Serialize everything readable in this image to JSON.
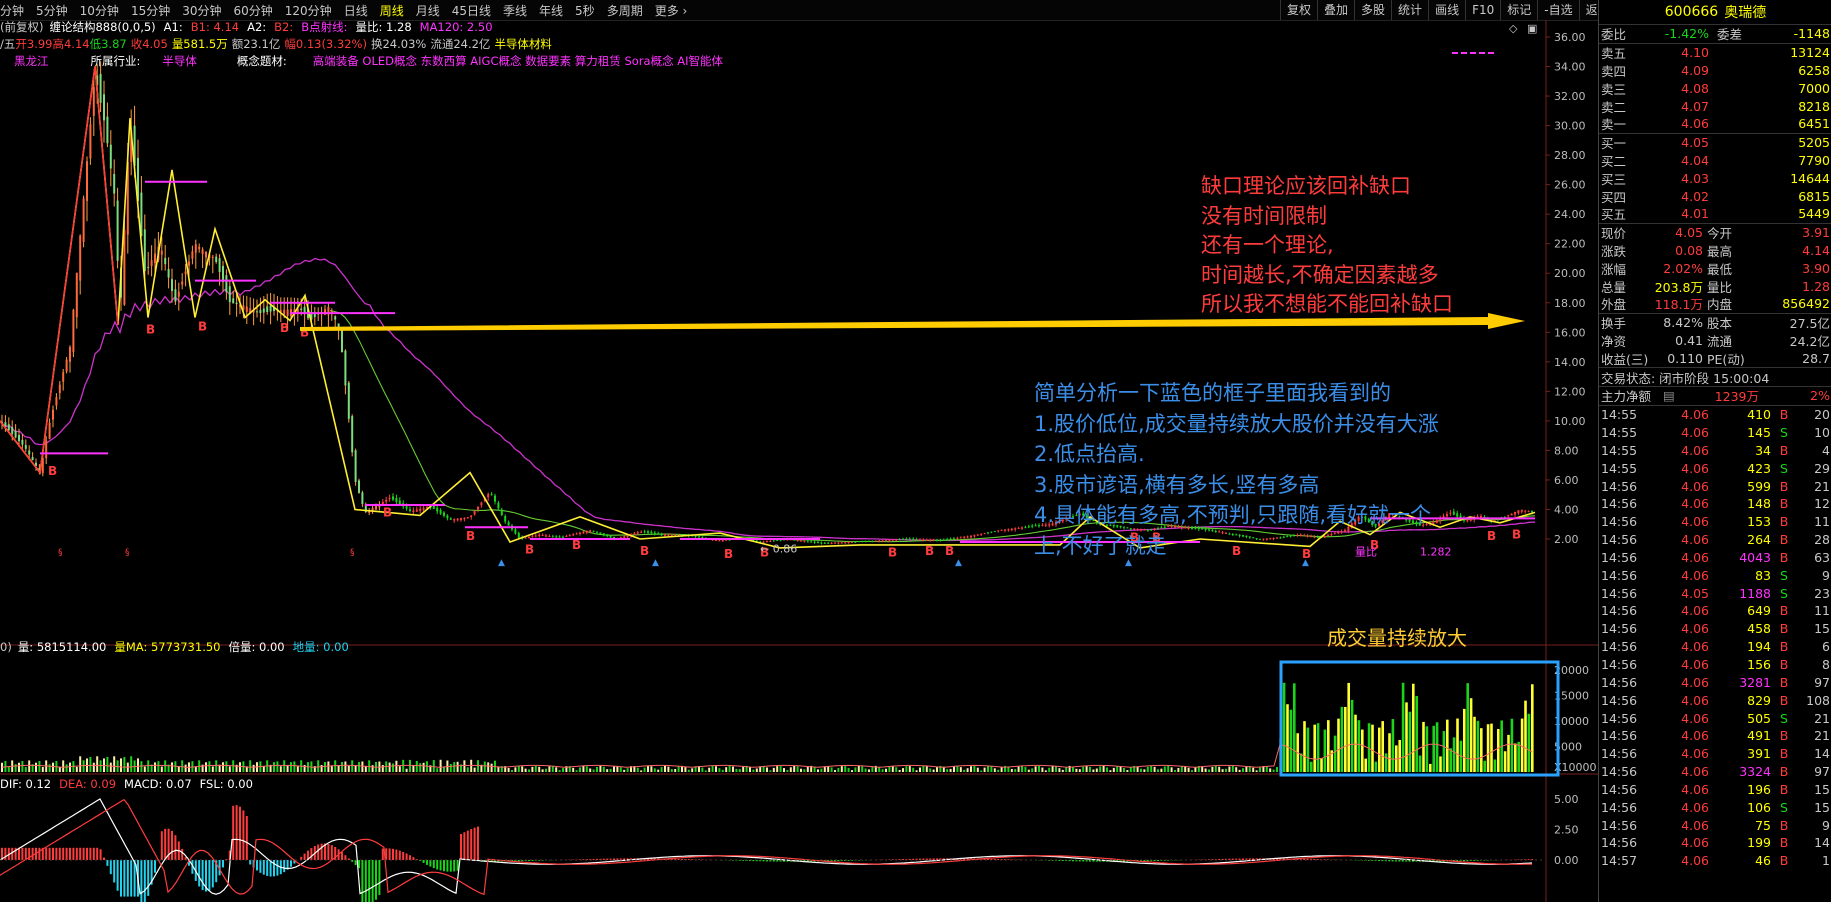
{
  "toolbar": {
    "periods": [
      "分钟",
      "5分钟",
      "10分钟",
      "15分钟",
      "30分钟",
      "60分钟",
      "120分钟",
      "日线",
      "周线",
      "月线",
      "45日线",
      "季线",
      "年线",
      "5秒",
      "多周期",
      "更多 ›"
    ],
    "active_period": "周线",
    "right_buttons": [
      "复权",
      "叠加",
      "多股",
      "统计",
      "画线",
      "F10",
      "标记",
      "-自选",
      "返回"
    ]
  },
  "info_line1": {
    "prefix": "(前复权)",
    "indicator": "缠论结构888(0,0,5)",
    "a1_label": "A1:",
    "b1": "B1: 4.14",
    "a2_label": "A2:",
    "b2_label": "B2:",
    "bline": "B点射线:",
    "volratio": "量比: 1.28",
    "ma120": "MA120: 2.50"
  },
  "info_line2": {
    "ohlc_prefix": "/五",
    "open": "开3.99",
    "high": "高4.14",
    "low": "低3.87",
    "close": "收4.05",
    "vol": "量581.5万",
    "amount": "额23.1亿",
    "amp": "幅0.13(3.32%)",
    "turnover": "换24.03%",
    "float": "流通24.2亿",
    "concept": "半导体材料"
  },
  "tags": {
    "region": "黑龙江",
    "industry_label": "所属行业:",
    "industry": "半导体",
    "concept_label": "概念题材:",
    "concepts": "高端装备 OLED概念 东数西算 AIGC概念 数据要素 算力租赁 Sora概念 AI智能体"
  },
  "price_axis": [
    "36.00",
    "34.00",
    "32.00",
    "30.00",
    "28.00",
    "26.00",
    "24.00",
    "22.00",
    "20.00",
    "18.00",
    "16.00",
    "14.00",
    "12.00",
    "10.00",
    "8.00",
    "6.00",
    "4.00",
    "2.00"
  ],
  "vol_axis": [
    "20000",
    "15000",
    "10000",
    "5000",
    "X10000"
  ],
  "macd_axis": [
    "5.00",
    "2.50",
    "0.00"
  ],
  "price_labels": {
    "low_marker": "0.86",
    "vol_ratio_marker": "量比",
    "vol_ratio_value": "1.282"
  },
  "vol_info": {
    "prefix": "0)",
    "vol": "量: 5815114.00",
    "volma": "量MA: 5773731.50",
    "bei": "倍量: 0.00",
    "di": "地量: 0.00"
  },
  "macd_info": {
    "dif": "DIF: 0.12",
    "dea": "DEA: 0.09",
    "macd": "MACD: 0.07",
    "fsl": "FSL: 0.00"
  },
  "annotations": {
    "gap_notes": [
      "缺口理论应该回补缺口",
      "没有时间限制",
      "还有一个理论,",
      "时间越长,不确定因素越多",
      "所以我不想能不能回补缺口"
    ],
    "analysis_notes": [
      "简单分析一下蓝色的框子里面我看到的",
      "1.股价低位,成交量持续放大股价并没有大涨",
      "2.低点抬高.",
      "3.股市谚语,横有多长,竖有多高",
      "4.具体能有多高,不预判,只跟随,看好就一个",
      "上,不好了就走"
    ],
    "volume_note": "成交量持续放大"
  },
  "quote": {
    "code": "600666",
    "name": "奥瑞德",
    "weibi_label": "委比",
    "weibi": "-1.42%",
    "weicha_label": "委差",
    "weicha": "-1148",
    "asks": [
      {
        "label": "卖五",
        "price": "4.10",
        "vol": "13124"
      },
      {
        "label": "卖四",
        "price": "4.09",
        "vol": "6258"
      },
      {
        "label": "卖三",
        "price": "4.08",
        "vol": "7000"
      },
      {
        "label": "卖二",
        "price": "4.07",
        "vol": "8218"
      },
      {
        "label": "卖一",
        "price": "4.06",
        "vol": "6451"
      }
    ],
    "bids": [
      {
        "label": "买一",
        "price": "4.05",
        "vol": "5205"
      },
      {
        "label": "买二",
        "price": "4.04",
        "vol": "7790"
      },
      {
        "label": "买三",
        "price": "4.03",
        "vol": "14644"
      },
      {
        "label": "买四",
        "price": "4.02",
        "vol": "6815"
      },
      {
        "label": "买五",
        "price": "4.01",
        "vol": "5449"
      }
    ],
    "stats": [
      {
        "l1": "现价",
        "v1": "4.05",
        "l2": "今开",
        "v2": "3.91"
      },
      {
        "l1": "涨跌",
        "v1": "0.08",
        "l2": "最高",
        "v2": "4.14"
      },
      {
        "l1": "涨幅",
        "v1": "2.02%",
        "l2": "最低",
        "v2": "3.90"
      },
      {
        "l1": "总量",
        "v1": "203.8万",
        "l2": "量比",
        "v2": "1.28"
      },
      {
        "l1": "外盘",
        "v1": "118.1万",
        "l2": "内盘",
        "v2": "856492"
      }
    ],
    "stats2": [
      {
        "l1": "换手",
        "v1": "8.42%",
        "l2": "股本",
        "v2": "27.5亿"
      },
      {
        "l1": "净资",
        "v1": "0.41",
        "l2": "流通",
        "v2": "24.2亿"
      },
      {
        "l1": "收益(三)",
        "v1": "0.110",
        "l2": "PE(动)",
        "v2": "28.7"
      }
    ],
    "trade_status": "交易状态: 闭市阶段 15:00:04",
    "flow_label": "主力净额",
    "flow_value": "1239万",
    "flow_pct": "2%",
    "ticks": [
      {
        "t": "14:55",
        "p": "4.06",
        "v": "410",
        "s": "B",
        "n": "20"
      },
      {
        "t": "14:55",
        "p": "4.06",
        "v": "145",
        "s": "S",
        "n": "10"
      },
      {
        "t": "14:55",
        "p": "4.06",
        "v": "34",
        "s": "B",
        "n": "4"
      },
      {
        "t": "14:55",
        "p": "4.06",
        "v": "423",
        "s": "S",
        "n": "29"
      },
      {
        "t": "14:56",
        "p": "4.06",
        "v": "599",
        "s": "B",
        "n": "21"
      },
      {
        "t": "14:56",
        "p": "4.06",
        "v": "148",
        "s": "B",
        "n": "12"
      },
      {
        "t": "14:56",
        "p": "4.06",
        "v": "153",
        "s": "B",
        "n": "11"
      },
      {
        "t": "14:56",
        "p": "4.06",
        "v": "264",
        "s": "B",
        "n": "28"
      },
      {
        "t": "14:56",
        "p": "4.06",
        "v": "4043",
        "s": "B",
        "n": "63"
      },
      {
        "t": "14:56",
        "p": "4.06",
        "v": "83",
        "s": "S",
        "n": "9"
      },
      {
        "t": "14:56",
        "p": "4.05",
        "v": "1188",
        "s": "S",
        "n": "23"
      },
      {
        "t": "14:56",
        "p": "4.06",
        "v": "649",
        "s": "B",
        "n": "11"
      },
      {
        "t": "14:56",
        "p": "4.06",
        "v": "458",
        "s": "B",
        "n": "15"
      },
      {
        "t": "14:56",
        "p": "4.06",
        "v": "194",
        "s": "B",
        "n": "6"
      },
      {
        "t": "14:56",
        "p": "4.06",
        "v": "156",
        "s": "B",
        "n": "8"
      },
      {
        "t": "14:56",
        "p": "4.06",
        "v": "3281",
        "s": "B",
        "n": "97"
      },
      {
        "t": "14:56",
        "p": "4.06",
        "v": "829",
        "s": "B",
        "n": "108"
      },
      {
        "t": "14:56",
        "p": "4.06",
        "v": "505",
        "s": "S",
        "n": "21"
      },
      {
        "t": "14:56",
        "p": "4.06",
        "v": "491",
        "s": "B",
        "n": "21"
      },
      {
        "t": "14:56",
        "p": "4.06",
        "v": "391",
        "s": "B",
        "n": "14"
      },
      {
        "t": "14:56",
        "p": "4.06",
        "v": "3324",
        "s": "B",
        "n": "97"
      },
      {
        "t": "14:56",
        "p": "4.06",
        "v": "196",
        "s": "B",
        "n": "15"
      },
      {
        "t": "14:56",
        "p": "4.06",
        "v": "106",
        "s": "S",
        "n": "15"
      },
      {
        "t": "14:56",
        "p": "4.06",
        "v": "75",
        "s": "B",
        "n": "9"
      },
      {
        "t": "14:56",
        "p": "4.06",
        "v": "199",
        "s": "B",
        "n": "14"
      },
      {
        "t": "14:57",
        "p": "4.06",
        "v": "46",
        "s": "B",
        "n": "1"
      }
    ]
  },
  "colors": {
    "up": "#ff3c3c",
    "down": "#19d419",
    "accent": "#ffff00",
    "concept": "#ff33ff",
    "note_red": "#ff3c3c",
    "note_blue": "#3b8ee8",
    "note_yellow": "#ffcc33",
    "box_blue": "#2aa0ff"
  }
}
